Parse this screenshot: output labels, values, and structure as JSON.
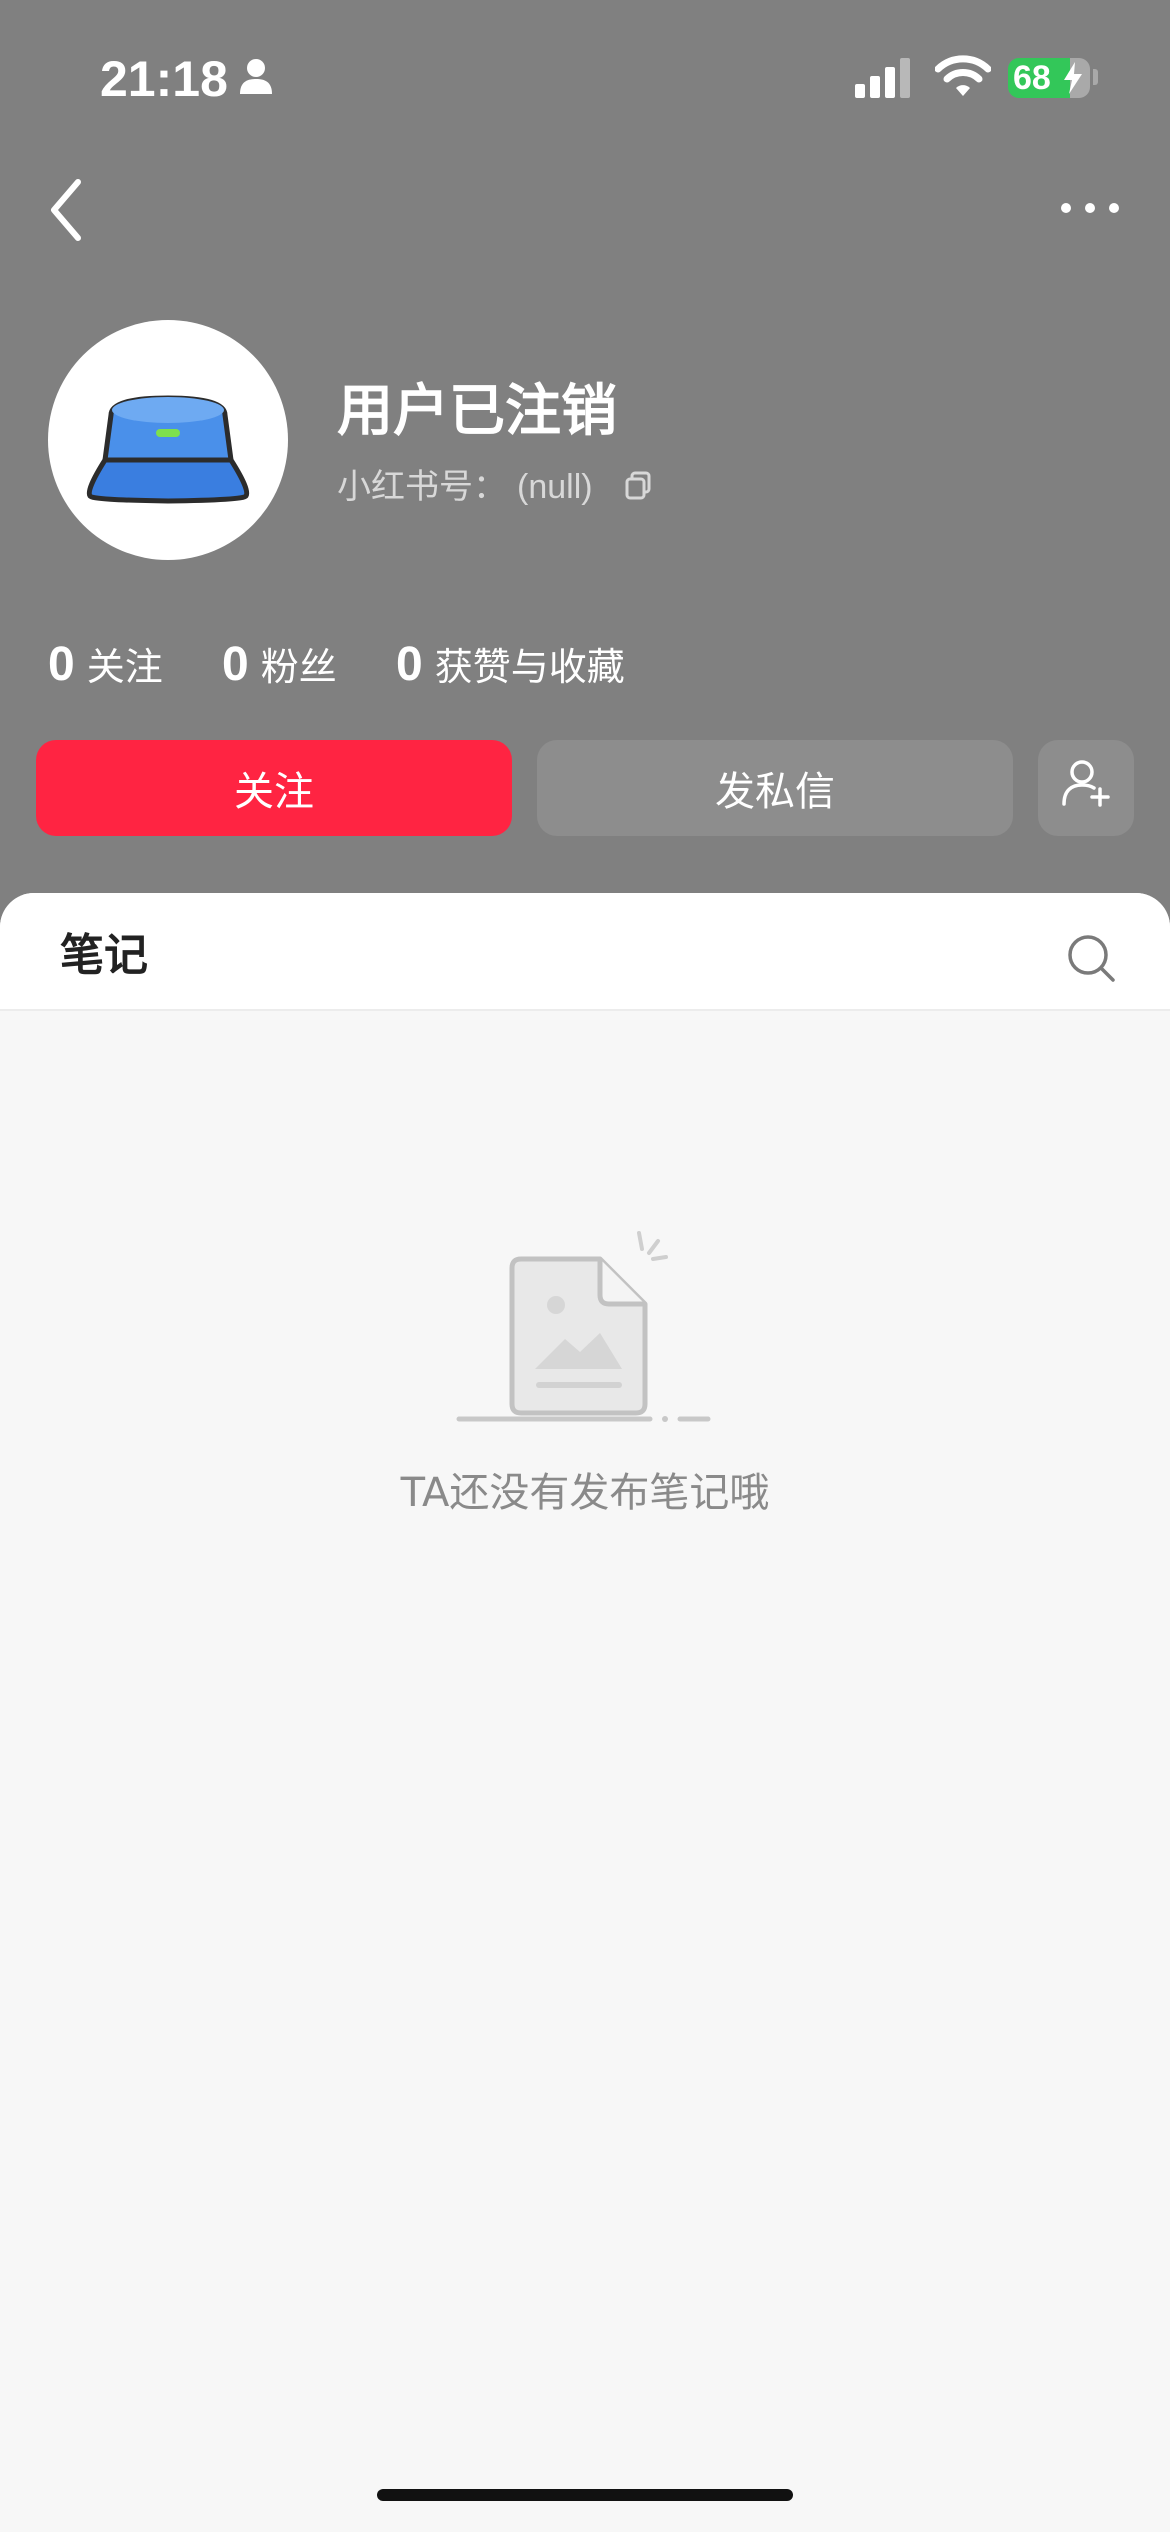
{
  "status_bar": {
    "time": "21:18",
    "battery_level": "68",
    "battery_color": "#33c759",
    "icons": [
      "person-icon",
      "cellular-signal-icon",
      "wifi-icon",
      "battery-charging-icon"
    ]
  },
  "nav": {
    "back_icon": "chevron-left-icon",
    "more_icon": "more-dots-icon"
  },
  "profile": {
    "username": "用户已注销",
    "id_label": "小红书号：",
    "id_value": "(null)",
    "copy_icon": "copy-icon",
    "avatar_icon": "bucket-hat-icon"
  },
  "stats": [
    {
      "count": "0",
      "label": "关注"
    },
    {
      "count": "0",
      "label": "粉丝"
    },
    {
      "count": "0",
      "label": "获赞与收藏"
    }
  ],
  "actions": {
    "follow_label": "关注",
    "follow_color": "#ff2442",
    "message_label": "发私信",
    "add_friend_icon": "add-user-icon"
  },
  "notes": {
    "tab_label": "笔记",
    "search_icon": "search-icon",
    "empty_text": "TA还没有发布笔记哦",
    "empty_icon": "empty-document-icon"
  }
}
